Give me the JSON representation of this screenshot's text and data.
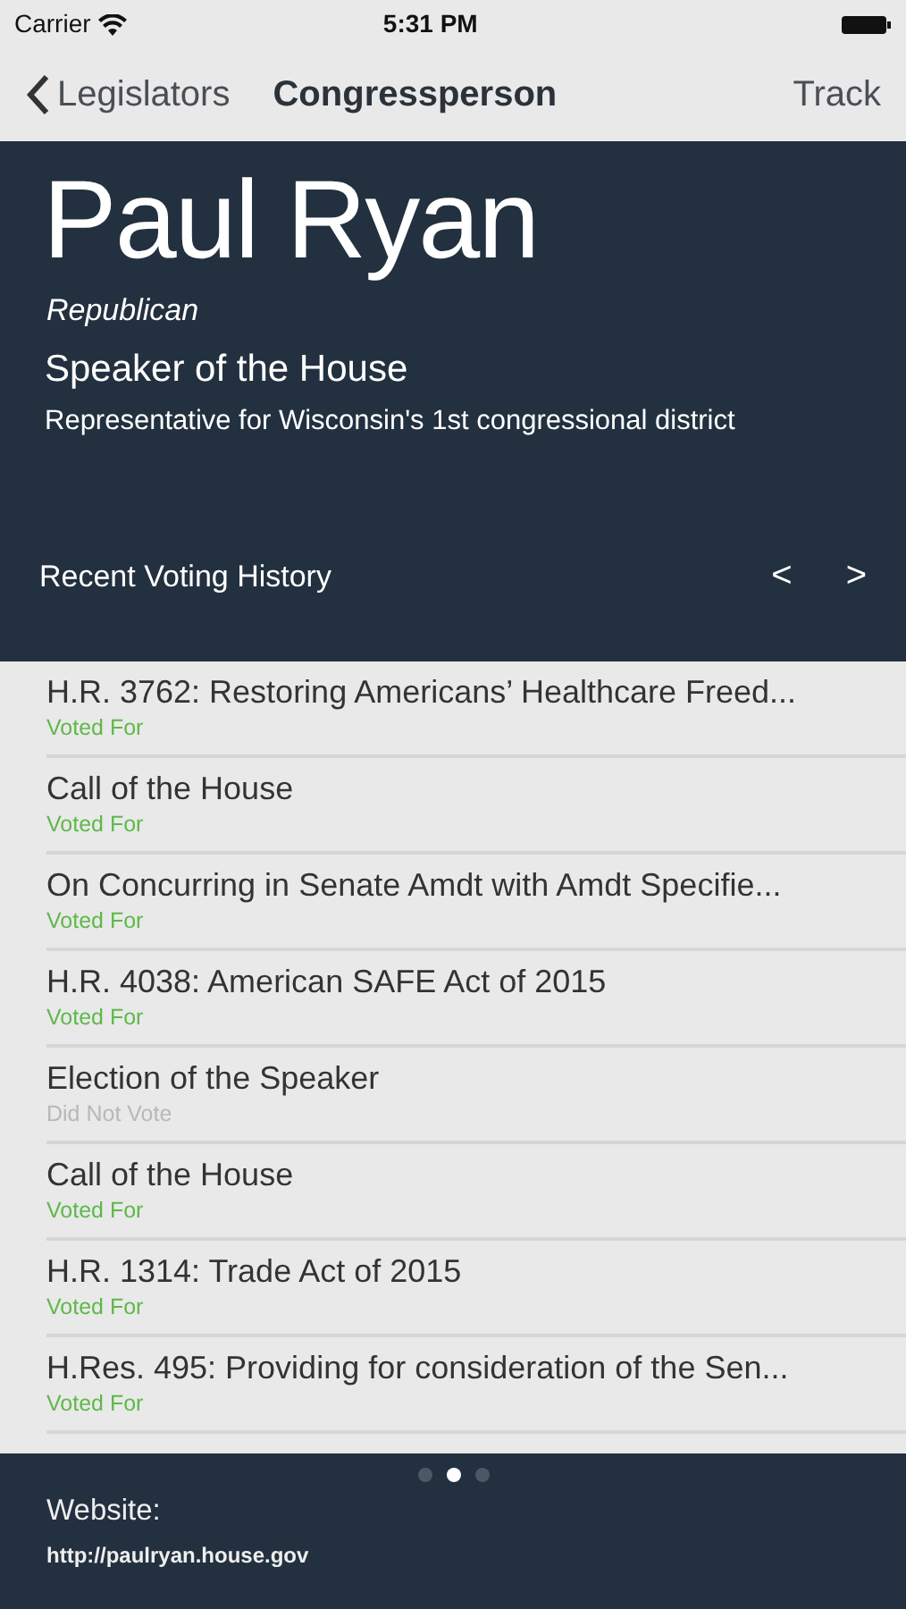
{
  "status_bar": {
    "carrier": "Carrier",
    "time": "5:31 PM"
  },
  "nav": {
    "back": "Legislators",
    "title": "Congressperson",
    "action": "Track"
  },
  "profile": {
    "name": "Paul Ryan",
    "party": "Republican",
    "role": "Speaker of the House",
    "district": "Representative for Wisconsin's 1st congressional district"
  },
  "voting_history": {
    "title": "Recent Voting History",
    "prev": "<",
    "next": ">"
  },
  "votes": [
    {
      "bill": "H.R. 3762: Restoring Americans’ Healthcare Freed...",
      "vote": "Voted For",
      "kind": "for"
    },
    {
      "bill": "Call of the House",
      "vote": "Voted For",
      "kind": "for"
    },
    {
      "bill": "On Concurring in Senate Amdt with Amdt Specifie...",
      "vote": "Voted For",
      "kind": "for"
    },
    {
      "bill": "H.R. 4038: American SAFE Act of 2015",
      "vote": "Voted For",
      "kind": "for"
    },
    {
      "bill": "Election of the Speaker",
      "vote": "Did Not Vote",
      "kind": "absent"
    },
    {
      "bill": "Call of the House",
      "vote": "Voted For",
      "kind": "for"
    },
    {
      "bill": "H.R. 1314: Trade Act of 2015",
      "vote": "Voted For",
      "kind": "for"
    },
    {
      "bill": "H.Res. 495: Providing for consideration of the Sen...",
      "vote": "Voted For",
      "kind": "for"
    }
  ],
  "page_dots": [
    {
      "selected": false
    },
    {
      "selected": true
    },
    {
      "selected": false
    }
  ],
  "footer": {
    "label": "Website:",
    "url": "http://paulryan.house.gov"
  }
}
